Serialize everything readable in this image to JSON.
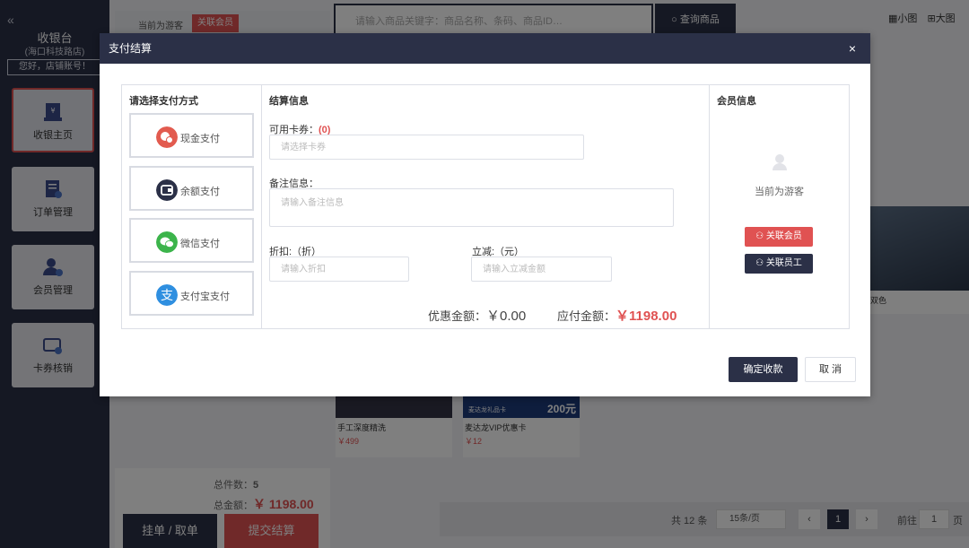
{
  "sidebar": {
    "title": "收银台",
    "store": "(海口科技路店)",
    "greeting": "您好，店铺账号！",
    "items": [
      {
        "label": "收银主页"
      },
      {
        "label": "订单管理"
      },
      {
        "label": "会员管理"
      },
      {
        "label": "卡券核销"
      }
    ]
  },
  "topbar": {
    "guest": "当前为游客",
    "link_member": "关联会员",
    "search_placeholder": "请输入商品关键字：商品名称、条码、商品ID…",
    "search_button": "查询商品",
    "view_small": "小图",
    "view_large": "大图"
  },
  "cart": {
    "count_label": "总件数：",
    "count": "5",
    "total_label": "总金额：",
    "total": "￥ 1198.00",
    "hang_button": "挂单 / 取单",
    "submit_button": "提交结算"
  },
  "products": [
    {
      "name": "手工深度精洗",
      "price": "￥499"
    },
    {
      "name": "麦达龙VIP优惠卡",
      "price": "￥12",
      "badge": "200元",
      "card_text": "麦达龙礼品卡"
    },
    {
      "name": "双色"
    }
  ],
  "pager": {
    "total": "共 12 条",
    "per_page": "15条/页",
    "current": "1",
    "goto_label": "前往",
    "goto_value": "1",
    "page_suffix": "页"
  },
  "dialog": {
    "title": "支付结算",
    "close": "×",
    "payment": {
      "title": "请选择支付方式",
      "options": [
        {
          "label": "现金支付",
          "color": "#e25b4f"
        },
        {
          "label": "余额支付",
          "color": "#2b3047"
        },
        {
          "label": "微信支付",
          "color": "#3cb44b"
        },
        {
          "label": "支付宝支付",
          "color": "#2f8fe0"
        }
      ]
    },
    "settlement": {
      "title": "结算信息",
      "coupon_label": "可用卡券：",
      "coupon_count": "(0)",
      "coupon_placeholder": "请选择卡券",
      "remark_label": "备注信息：",
      "remark_placeholder": "请输入备注信息",
      "discount_label": "折扣:（折）",
      "discount_placeholder": "请输入折扣",
      "reduce_label": "立减:（元）",
      "reduce_placeholder": "请输入立减金额",
      "saving_label": "优惠金额：",
      "saving_value": "￥0.00",
      "payable_label": "应付金额：",
      "payable_value": "￥1198.00"
    },
    "member": {
      "title": "会员信息",
      "empty": "当前为游客",
      "link_member": "关联会员",
      "link_staff": "关联员工"
    },
    "confirm": "确定收款",
    "cancel": "取 消"
  },
  "colors": {
    "accent": "#2b3047",
    "danger": "#e05252"
  }
}
